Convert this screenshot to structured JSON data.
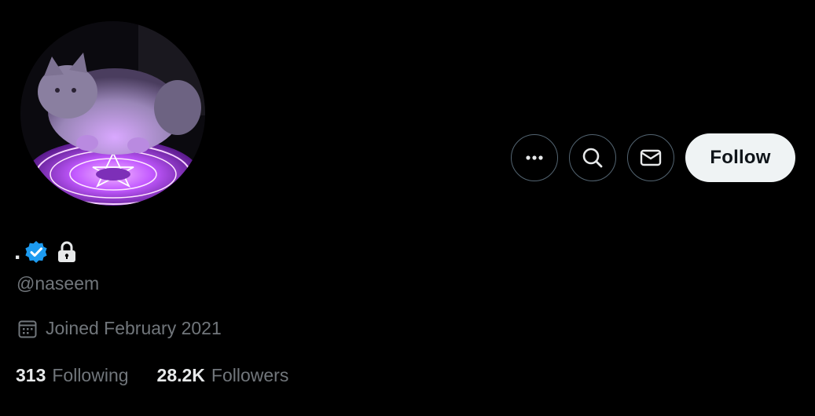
{
  "profile": {
    "display_name": ".",
    "handle": "@naseem",
    "joined": "Joined February 2021",
    "verified": true,
    "protected": true,
    "avatar_description": "cat-on-glowing-magic-circle"
  },
  "actions": {
    "more_icon": "more-horizontal-icon",
    "search_icon": "search-icon",
    "message_icon": "envelope-icon",
    "follow_label": "Follow"
  },
  "stats": {
    "following_count": "313",
    "following_label": "Following",
    "followers_count": "28.2K",
    "followers_label": "Followers"
  },
  "colors": {
    "background": "#000000",
    "primary_text": "#e7e9ea",
    "secondary_text": "#71767b",
    "verified_blue": "#1d9bf0",
    "follow_bg": "#eff3f4",
    "border": "#536471",
    "glow_purple": "#c259ff"
  }
}
